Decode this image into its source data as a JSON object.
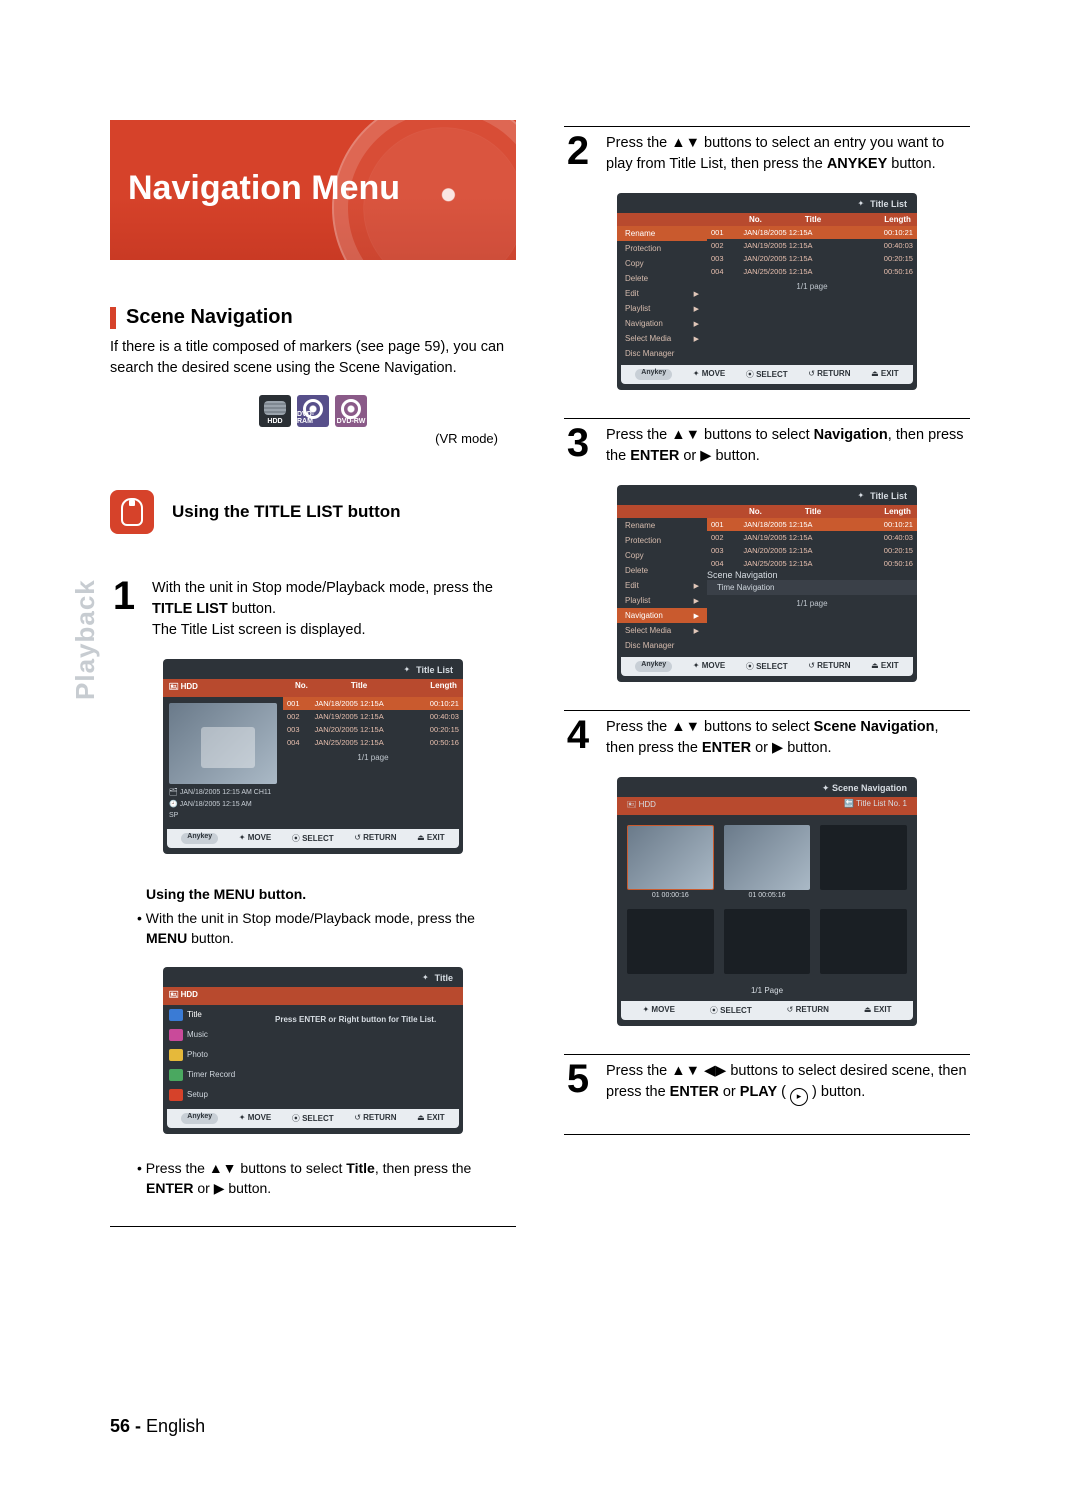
{
  "banner": {
    "title": "Navigation Menu"
  },
  "scene_nav": {
    "heading": "Scene Navigation",
    "intro": "If there is a title composed of markers (see page 59), you can search the desired scene using the Scene Navigation.",
    "discs": {
      "hdd": "HDD",
      "ram": "DVD-RAM",
      "rw": "DVD-RW"
    },
    "vr_note": "(VR mode)"
  },
  "step_title": "Using the TITLE LIST button",
  "step1": {
    "num": "1",
    "line1a": "With the unit in Stop mode/Playback mode, press the ",
    "line1b": "TITLE LIST",
    "line1c": " button.",
    "line2": "The Title List screen is displayed."
  },
  "menu_heading": "Using the MENU button.",
  "menu_b1a": "With the unit in Stop mode/Playback mode, press the ",
  "menu_b1b": "MENU",
  "menu_b1c": " button.",
  "menu_b2a": "Press the ",
  "menu_b2b": "▲▼",
  "menu_b2c": " buttons to select ",
  "menu_b2d": "Title",
  "menu_b2e": ", then press the ",
  "menu_b2f": "ENTER",
  "menu_b2g": " or ",
  "menu_b2h": "▶",
  "menu_b2i": " button.",
  "step2": {
    "num": "2",
    "a": "Press the ",
    "b": "▲▼",
    "c": " buttons to select an entry you want to play from Title List, then press the ",
    "d": "ANYKEY",
    "e": " button."
  },
  "step3": {
    "num": "3",
    "a": "Press the ",
    "b": "▲▼",
    "c": " buttons to select ",
    "d": "Navigation",
    "e": ", then press the ",
    "f": "ENTER",
    "g": " or ",
    "h": "▶",
    "i": " button."
  },
  "step4": {
    "num": "4",
    "a": "Press the ",
    "b": "▲▼",
    "c": " buttons to select ",
    "d": "Scene Navigation",
    "e": ", then press the ",
    "f": "ENTER",
    "g": " or ",
    "h": "▶",
    "i": " button."
  },
  "step5": {
    "num": "5",
    "a": "Press the ",
    "b": "▲▼ ◀▶",
    "c": " buttons to select desired scene, then press the ",
    "d": "ENTER",
    "e": " or ",
    "f": "PLAY",
    "g": " button."
  },
  "ss_title_list": {
    "title": "Title List",
    "hdr_left": "HDD",
    "col_no": "No.",
    "col_title": "Title",
    "col_len": "Length",
    "rows": [
      {
        "no": "001",
        "title": "JAN/18/2005 12:15A",
        "len": "00:10:21"
      },
      {
        "no": "002",
        "title": "JAN/19/2005 12:15A",
        "len": "00:40:03"
      },
      {
        "no": "003",
        "title": "JAN/20/2005 12:15A",
        "len": "00:20:15"
      },
      {
        "no": "004",
        "title": "JAN/25/2005 12:15A",
        "len": "00:50:16"
      }
    ],
    "meta1": "JAN/18/2005 12:15 AM CH11",
    "meta2": "JAN/18/2005 12:15 AM",
    "meta3": "SP",
    "page": "1/1 page",
    "anykey": "Anykey",
    "f_move": "MOVE",
    "f_select": "SELECT",
    "f_return": "RETURN",
    "f_exit": "EXIT"
  },
  "ss_menu": {
    "title": "Title",
    "hdd": "HDD",
    "items": [
      "Title",
      "Music",
      "Photo",
      "Timer Record",
      "Setup"
    ],
    "hint": "Press ENTER or Right button for Title List."
  },
  "ss_popup": {
    "items": [
      "Rename",
      "Protection",
      "Copy",
      "Delete",
      "Edit",
      "Playlist",
      "Navigation",
      "Select Media",
      "Disc Manager"
    ]
  },
  "ss_subnav": {
    "items": [
      "Scene Navigation",
      "Time Navigation"
    ]
  },
  "ss_scene": {
    "title": "Scene Navigation",
    "hdd": "HDD",
    "crumb": "Title List  No. 1",
    "lab1": "01  00:00:16",
    "lab2": "01  00:05:16",
    "page": "1/1 Page"
  },
  "sidetab": "Playback",
  "footer": {
    "page": "56 -",
    "lang": "English"
  }
}
